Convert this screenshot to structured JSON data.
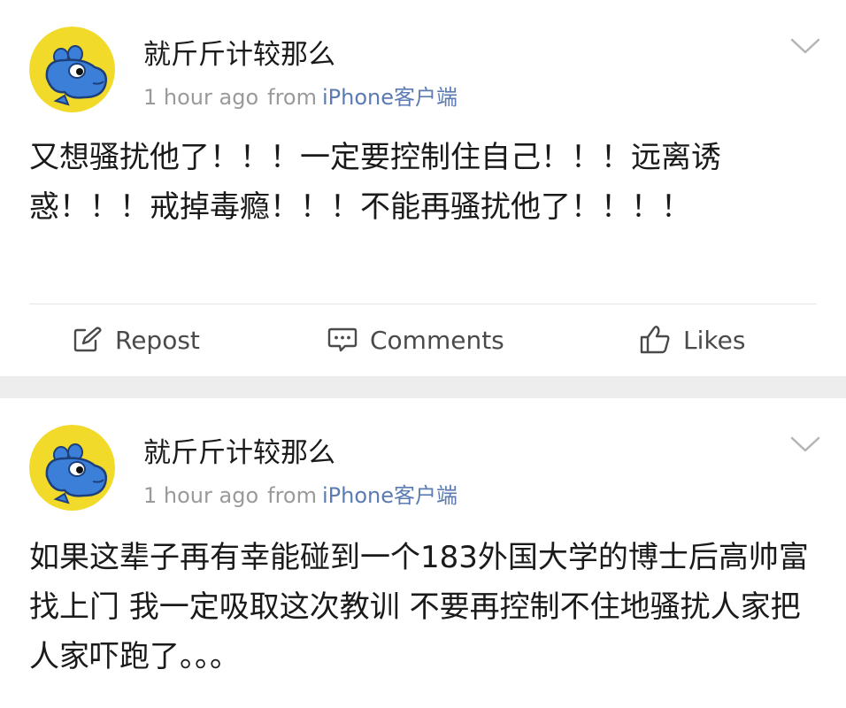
{
  "posts": [
    {
      "username": "就斤斤计较那么",
      "time": "1 hour ago",
      "from_label": "from",
      "source": "iPhone客户端",
      "text": "又想骚扰他了！！！一定要控制住自己！！！远离诱惑！！！戒掉毒瘾！！！不能再骚扰他了！！！！",
      "actions": {
        "repost": "Repost",
        "comments": "Comments",
        "likes": "Likes"
      }
    },
    {
      "username": "就斤斤计较那么",
      "time": "1 hour ago",
      "from_label": "from",
      "source": "iPhone客户端",
      "text": "如果这辈子再有幸能碰到一个183外国大学的博士后高帅富找上门 我一定吸取这次教训 不要再控制不住地骚扰人家把人家吓跑了。。。"
    }
  ],
  "icons": {
    "avatar": "blue-hippo-avatar",
    "menu": "chevron-down-icon",
    "repost": "repost-icon",
    "comments": "comment-icon",
    "likes": "thumbs-up-icon"
  },
  "colors": {
    "link_blue": "#5b7bb2",
    "meta_gray": "#9a9a9a",
    "separator": "#ededed",
    "avatar_bg": "#f2da2a",
    "hippo_blue": "#3c7fd8"
  }
}
